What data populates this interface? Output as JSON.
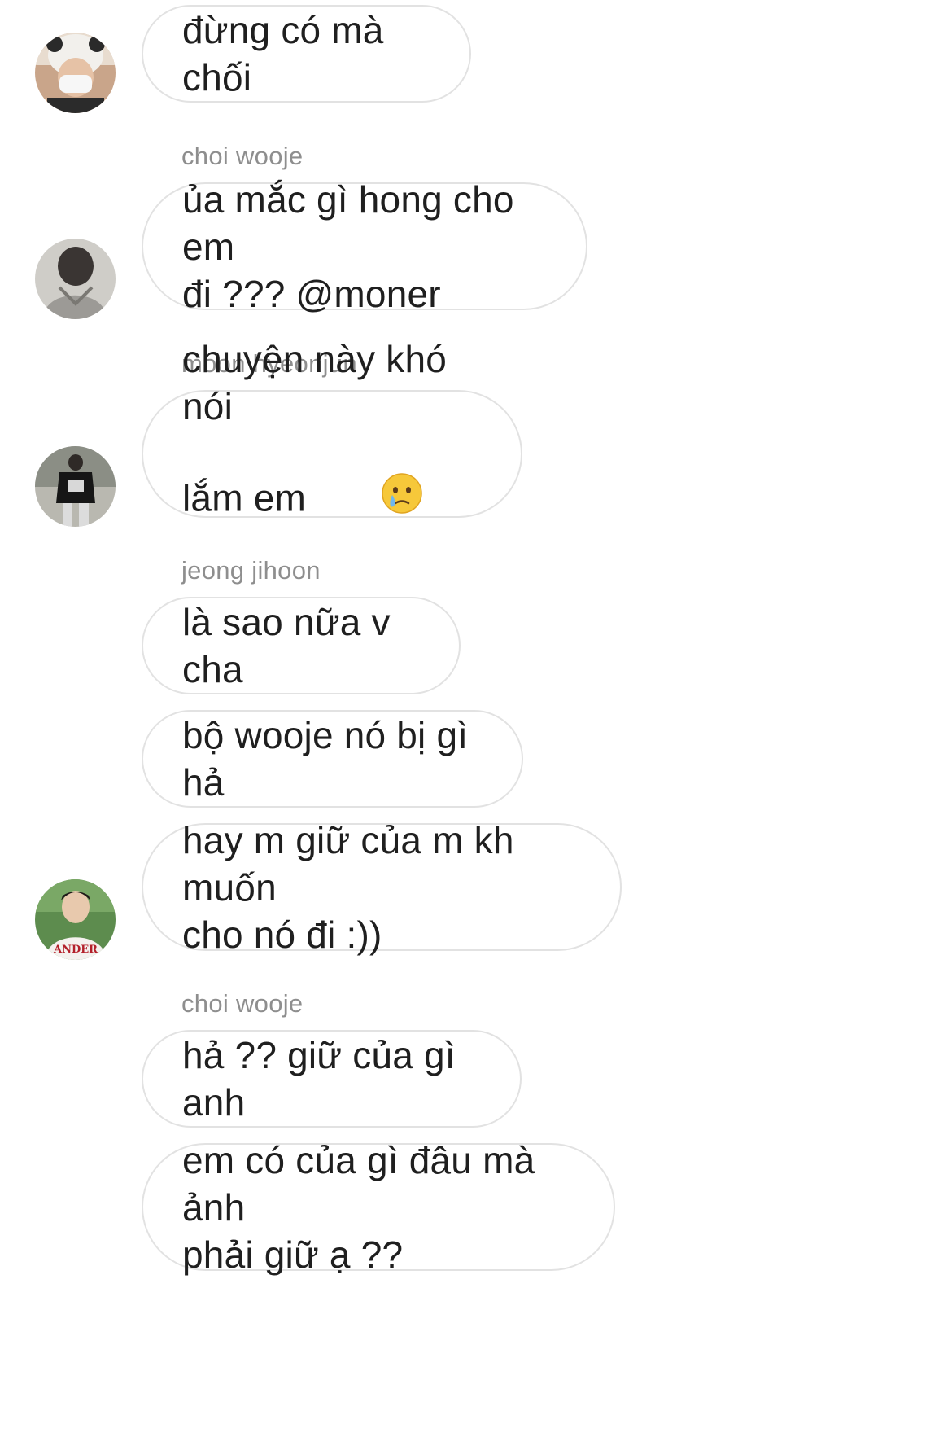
{
  "messages": [
    {
      "text": "đừng có mà chối"
    },
    {
      "sender": "choi wooje",
      "text": "ủa mắc gì hong cho em\nđi ??? @moner"
    },
    {
      "sender": "moon hyeonjun",
      "text": "chuyện này khó nói\nlắm em",
      "emoji": "crying-face-emoji"
    },
    {
      "sender": "jeong jihoon",
      "text": "là sao nữa v cha"
    },
    {
      "text": "bộ wooje nó bị gì hả"
    },
    {
      "text": "hay m giữ của m kh muốn\ncho nó đi :))"
    },
    {
      "sender": "choi wooje",
      "text": "hả ?? giữ của gì anh"
    },
    {
      "text": "em có của gì đâu mà ảnh\nphải giữ ạ ??"
    }
  ],
  "colors": {
    "bubble_border": "#e2e2e2",
    "sender_text": "#8e8e8e",
    "message_text": "#1f1f1f"
  }
}
